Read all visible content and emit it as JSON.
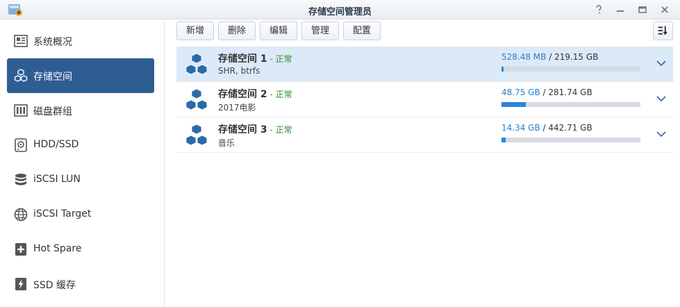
{
  "window": {
    "title": "存储空间管理员",
    "controls": [
      "help-icon",
      "minimize-icon",
      "maximize-icon",
      "close-icon"
    ]
  },
  "sidebar": {
    "items": [
      {
        "label": "系统概况",
        "icon": "overview-icon",
        "active": false
      },
      {
        "label": "存储空间",
        "icon": "volume-cubes-icon",
        "active": true
      },
      {
        "label": "磁盘群组",
        "icon": "disk-group-icon",
        "active": false
      },
      {
        "label": "HDD/SSD",
        "icon": "hdd-icon",
        "active": false
      },
      {
        "label": "iSCSI LUN",
        "icon": "database-icon",
        "active": false
      },
      {
        "label": "iSCSI Target",
        "icon": "globe-icon",
        "active": false
      },
      {
        "label": "Hot Spare",
        "icon": "hot-spare-plus-icon",
        "active": false
      },
      {
        "label": "SSD 缓存",
        "icon": "ssd-cache-lightning-icon",
        "active": false
      }
    ]
  },
  "toolbar": {
    "create_label": "新增",
    "delete_label": "删除",
    "edit_label": "编辑",
    "manage_label": "管理",
    "config_label": "配置",
    "sort_icon": "sort-icon"
  },
  "volumes": [
    {
      "name": "存储空间 1",
      "sep": " - ",
      "status": "正常",
      "desc": "SHR, btrfs",
      "used": "528.48 MB",
      "total": " / 219.15 GB",
      "usage_fraction": 0.0024,
      "selected": true
    },
    {
      "name": "存储空间 2",
      "sep": " - ",
      "status": "正常",
      "desc": "2017电影",
      "used": "48.75 GB",
      "total": " / 281.74 GB",
      "usage_fraction": 0.173,
      "selected": false
    },
    {
      "name": "存储空间 3",
      "sep": " - ",
      "status": "正常",
      "desc": "音乐",
      "used": "14.34 GB",
      "total": " / 442.71 GB",
      "usage_fraction": 0.032,
      "selected": false
    }
  ],
  "colors": {
    "accent": "#2e5d94",
    "status_ok": "#2a8a2a",
    "usage_bar": "#2a86d6",
    "selected_row": "#dce9f8"
  }
}
